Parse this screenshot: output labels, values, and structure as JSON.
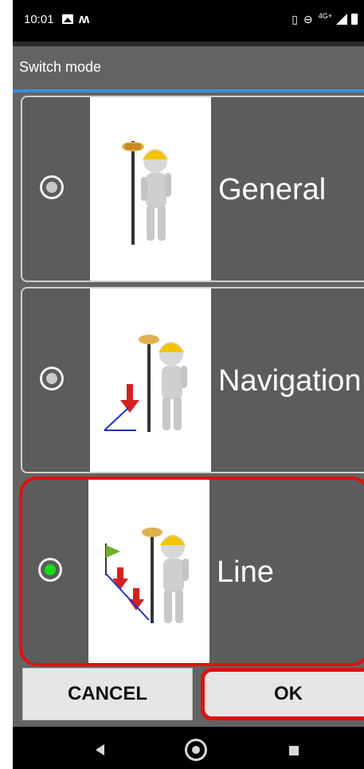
{
  "status_bar": {
    "time": "10:01",
    "icons": [
      "image-icon",
      "m-logo-icon"
    ],
    "right_icons": [
      "vibrate-icon",
      "dnd-icon",
      "signal-icon",
      "battery-icon"
    ],
    "network": "4G+"
  },
  "dialog": {
    "title": "Switch mode",
    "options": [
      {
        "label": "General",
        "selected": false,
        "thumbnail": "surveyor-figure"
      },
      {
        "label": "Navigation",
        "selected": false,
        "thumbnail": "surveyor-navigation-figure"
      },
      {
        "label": "Line",
        "selected": true,
        "thumbnail": "surveyor-line-figure"
      }
    ],
    "cancel_label": "CANCEL",
    "ok_label": "OK"
  },
  "colors": {
    "dialog_bg": "#636363",
    "accent": "#3a8fd6",
    "highlight": "#e01010",
    "radio_selected": "#11e011"
  },
  "nav_bar": {
    "icons": [
      "back-icon",
      "home-icon",
      "recents-icon"
    ]
  }
}
